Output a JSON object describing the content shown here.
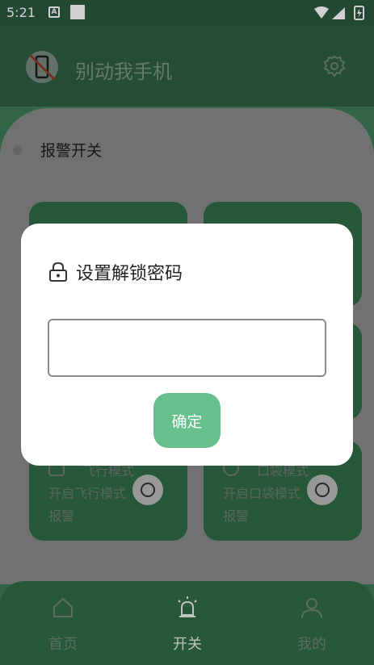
{
  "status_bar": {
    "time": "5:21",
    "a_icon": "A"
  },
  "header": {
    "title": "别动我手机",
    "logo_icon": "phone-slash-icon",
    "settings_icon": "gear-icon"
  },
  "main": {
    "alarm_switch_label": "报警开关",
    "cards": [
      {
        "title": "飞行模式",
        "desc": "开启飞行模式报警",
        "icon": "airplane-icon"
      },
      {
        "title": "口袋模式",
        "desc": "开启口袋模式报警",
        "icon": "pocket-icon"
      }
    ]
  },
  "bottom_nav": {
    "items": [
      {
        "label": "首页",
        "icon": "home-icon",
        "active": false
      },
      {
        "label": "开关",
        "icon": "alarm-icon",
        "active": true
      },
      {
        "label": "我的",
        "icon": "user-icon",
        "active": false
      }
    ]
  },
  "dialog": {
    "title": "设置解锁密码",
    "icon": "lock-icon",
    "password_value": "",
    "confirm_label": "确定"
  }
}
